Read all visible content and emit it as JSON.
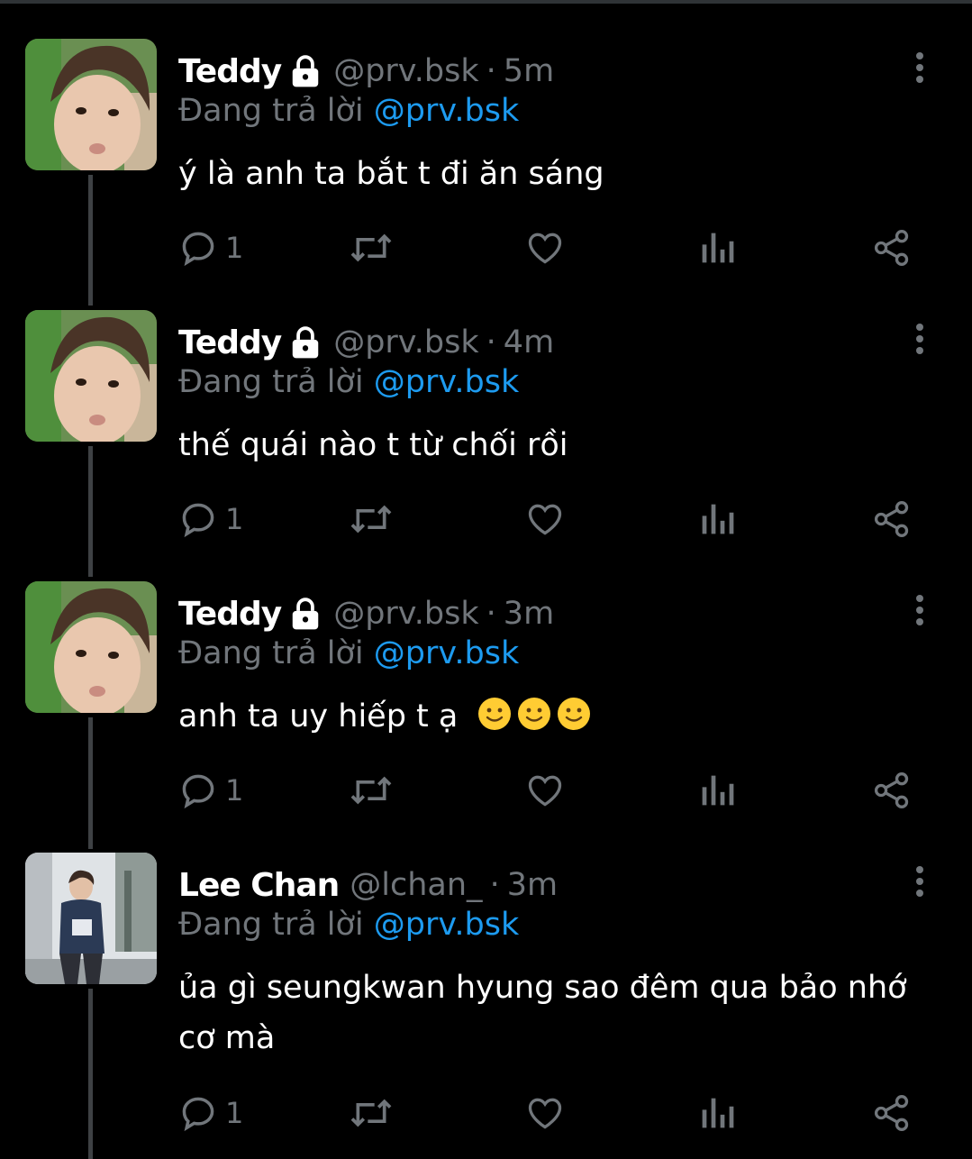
{
  "tweets": [
    {
      "name": "Teddy",
      "locked": true,
      "handle": "@prv.bsk",
      "sep": "·",
      "time": "5m",
      "reply_prefix": "Đang trả lời",
      "reply_to": "@prv.bsk",
      "text": "ý là anh ta bắt t đi ăn sáng",
      "reply_count": "1",
      "avatar": "avatar-teddy"
    },
    {
      "name": "Teddy",
      "locked": true,
      "handle": "@prv.bsk",
      "sep": "·",
      "time": "4m",
      "reply_prefix": "Đang trả lời",
      "reply_to": "@prv.bsk",
      "text": "thế quái nào t từ chối rồi",
      "reply_count": "1",
      "avatar": "avatar-teddy"
    },
    {
      "name": "Teddy",
      "locked": true,
      "handle": "@prv.bsk",
      "sep": "·",
      "time": "3m",
      "reply_prefix": "Đang trả lời",
      "reply_to": "@prv.bsk",
      "text": "anh ta uy hiếp t ạ",
      "emoji": [
        "slightly-smiling-face-emoji",
        "slightly-smiling-face-emoji",
        "slightly-smiling-face-emoji"
      ],
      "reply_count": "1",
      "avatar": "avatar-teddy"
    },
    {
      "name": "Lee Chan",
      "locked": false,
      "handle": "@lchan_",
      "sep": "·",
      "time": "3m",
      "reply_prefix": "Đang trả lời",
      "reply_to": "@prv.bsk",
      "text": "ủa gì seungkwan hyung sao đêm qua bảo nhớ cơ mà",
      "reply_count": "1",
      "avatar": "avatar-lee-chan"
    }
  ],
  "icons": [
    "reply-icon",
    "retweet-icon",
    "like-icon",
    "views-icon",
    "share-icon",
    "more-icon",
    "lock-icon"
  ],
  "colors": {
    "background": "#000000",
    "text": "#ffffff",
    "muted": "#71767b",
    "mention": "#1d9bf0",
    "thread_line": "#3e4144"
  }
}
